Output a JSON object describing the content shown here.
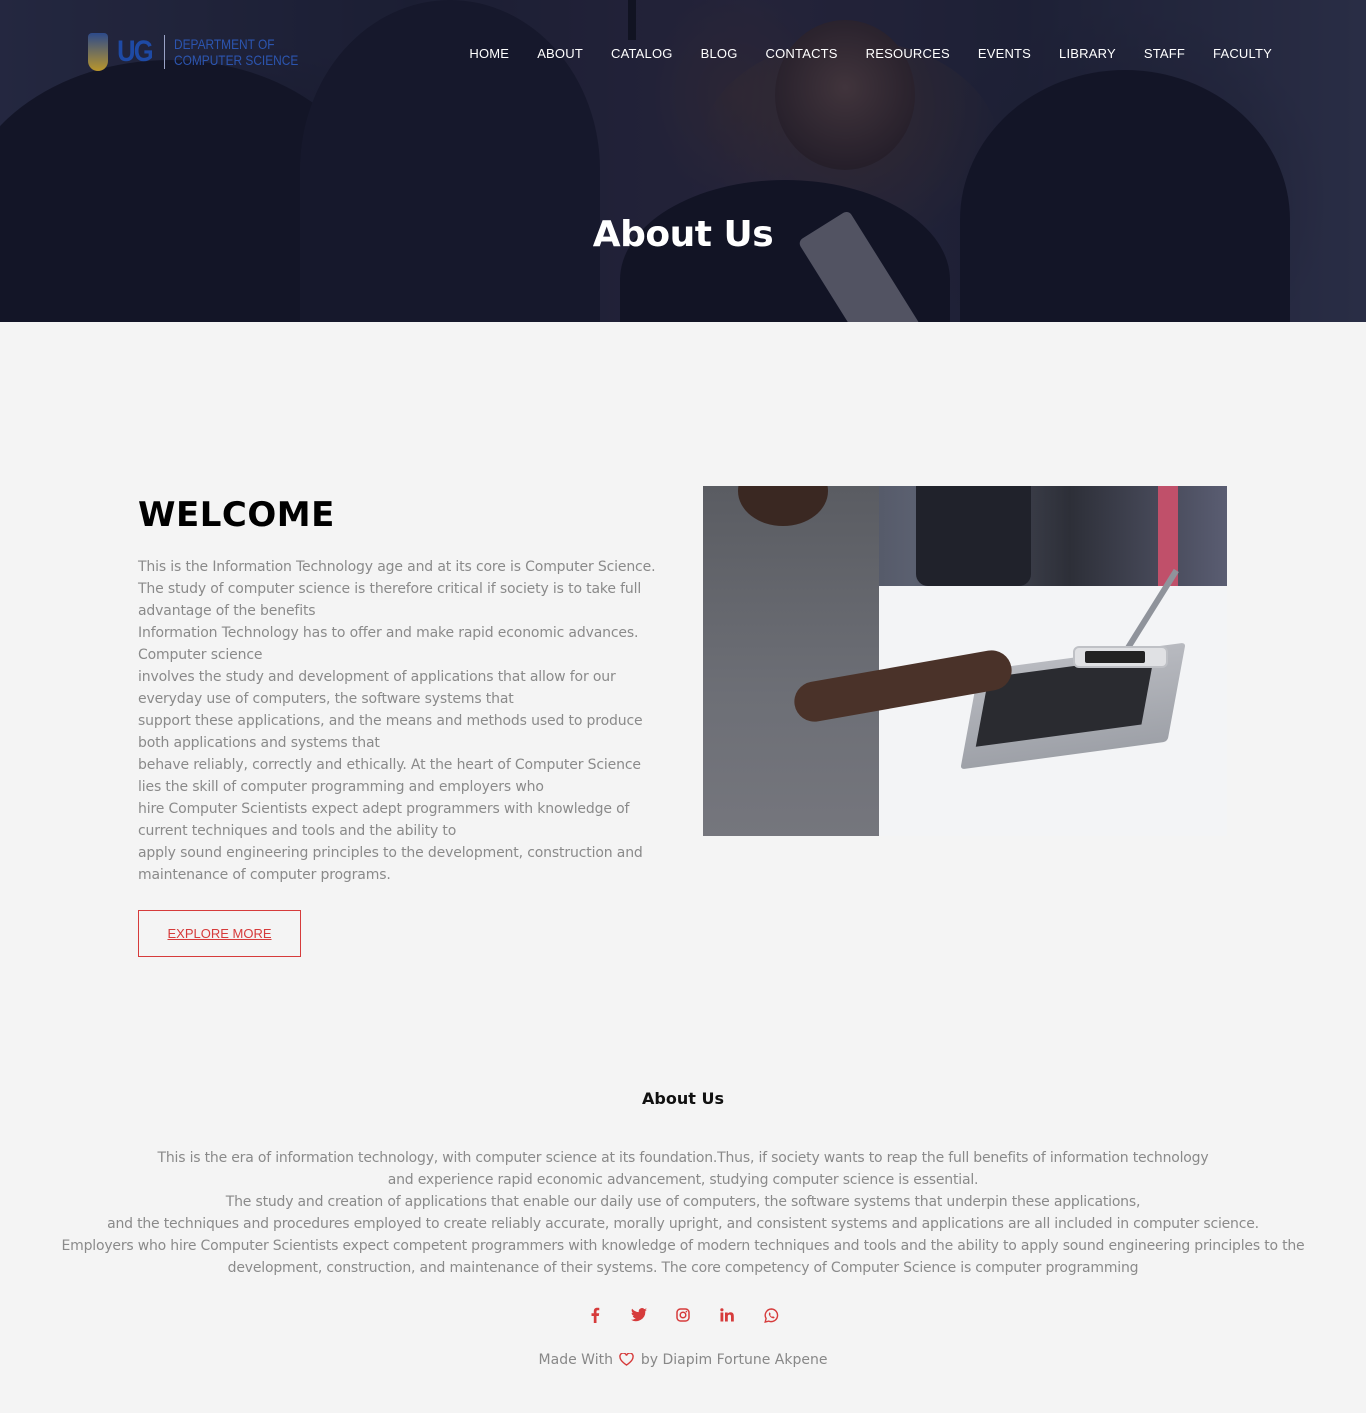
{
  "brand": {
    "logo_mark": "UG",
    "logo_text_line1": "DEPARTMENT OF",
    "logo_text_line2": "COMPUTER SCIENCE"
  },
  "nav": {
    "items": [
      {
        "label": "HOME"
      },
      {
        "label": "ABOUT"
      },
      {
        "label": "CATALOG"
      },
      {
        "label": "BLOG"
      },
      {
        "label": "CONTACTS"
      },
      {
        "label": "RESOURCES"
      },
      {
        "label": "EVENTS"
      },
      {
        "label": "LIBRARY"
      },
      {
        "label": "STAFF"
      },
      {
        "label": "FACULTY"
      }
    ]
  },
  "hero": {
    "title": "About Us"
  },
  "welcome": {
    "title": "WELCOME",
    "lines": [
      "This is the Information Technology age and at its core is Computer Science.",
      "The study of computer science is therefore critical if society is to take full",
      "advantage of the benefits",
      "Information Technology has to offer and make rapid economic advances.",
      "Computer science",
      "involves the study and development of applications that allow for our",
      "everyday use of computers, the software systems that",
      "support these applications, and the means and methods used to produce",
      "both applications and systems that",
      "behave reliably, correctly and ethically. At the heart of Computer Science",
      "lies the skill of computer programming and employers who",
      "hire Computer Scientists expect adept programmers with knowledge of",
      "current techniques and tools and the ability to",
      "apply sound engineering principles to the development, construction and",
      "maintenance of computer programs."
    ],
    "button_label": "EXPLORE MORE"
  },
  "footer": {
    "heading": "About Us",
    "lines": [
      "This is the era of information technology, with computer science at its foundation.Thus, if society wants to reap the full benefits of information technology",
      "and experience rapid economic advancement, studying computer science is essential.",
      "The study and creation of applications that enable our daily use of computers, the software systems that underpin these applications,",
      "and the techniques and procedures employed to create reliably accurate, morally upright, and consistent systems and applications are all included in computer science.",
      "Employers who hire Computer Scientists expect competent programmers with knowledge of modern techniques and tools and the ability to apply sound engineering principles to the",
      "development, construction, and maintenance of their systems. The core competency of Computer Science is computer programming"
    ],
    "social_icons": [
      "facebook-icon",
      "twitter-icon",
      "instagram-icon",
      "linkedin-icon",
      "whatsapp-icon"
    ],
    "credit_prefix": "Made With",
    "credit_suffix": "by Diapim Fortune Akpene"
  },
  "colors": {
    "accent": "#d63b3b",
    "hero_overlay": "#12163280",
    "background": "#f4f4f4"
  }
}
